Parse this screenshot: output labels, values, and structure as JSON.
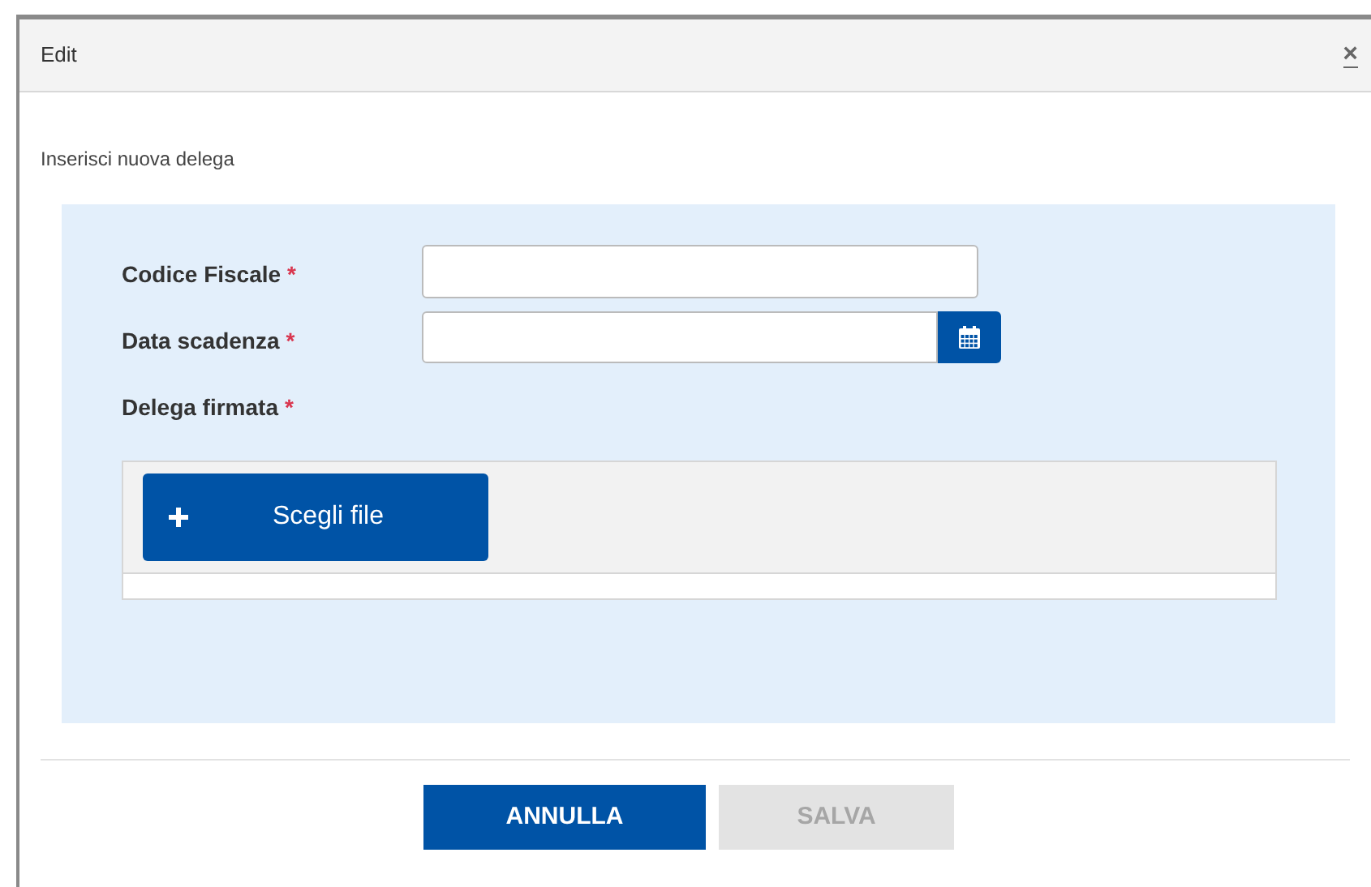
{
  "dialog": {
    "title": "Edit",
    "close": "×"
  },
  "subtitle": "Inserisci nuova delega",
  "fields": [
    {
      "kind": "text",
      "label": "Codice Fiscale",
      "required_mark": "*"
    },
    {
      "kind": "date",
      "label": "Data scadenza",
      "required_mark": "*"
    },
    {
      "kind": "file",
      "label": "Delega firmata",
      "required_mark": "*",
      "button": "Scegli file"
    }
  ],
  "buttons": [
    {
      "label": "ANNULLA",
      "disabled": false
    },
    {
      "label": "SALVA",
      "disabled": true
    }
  ]
}
